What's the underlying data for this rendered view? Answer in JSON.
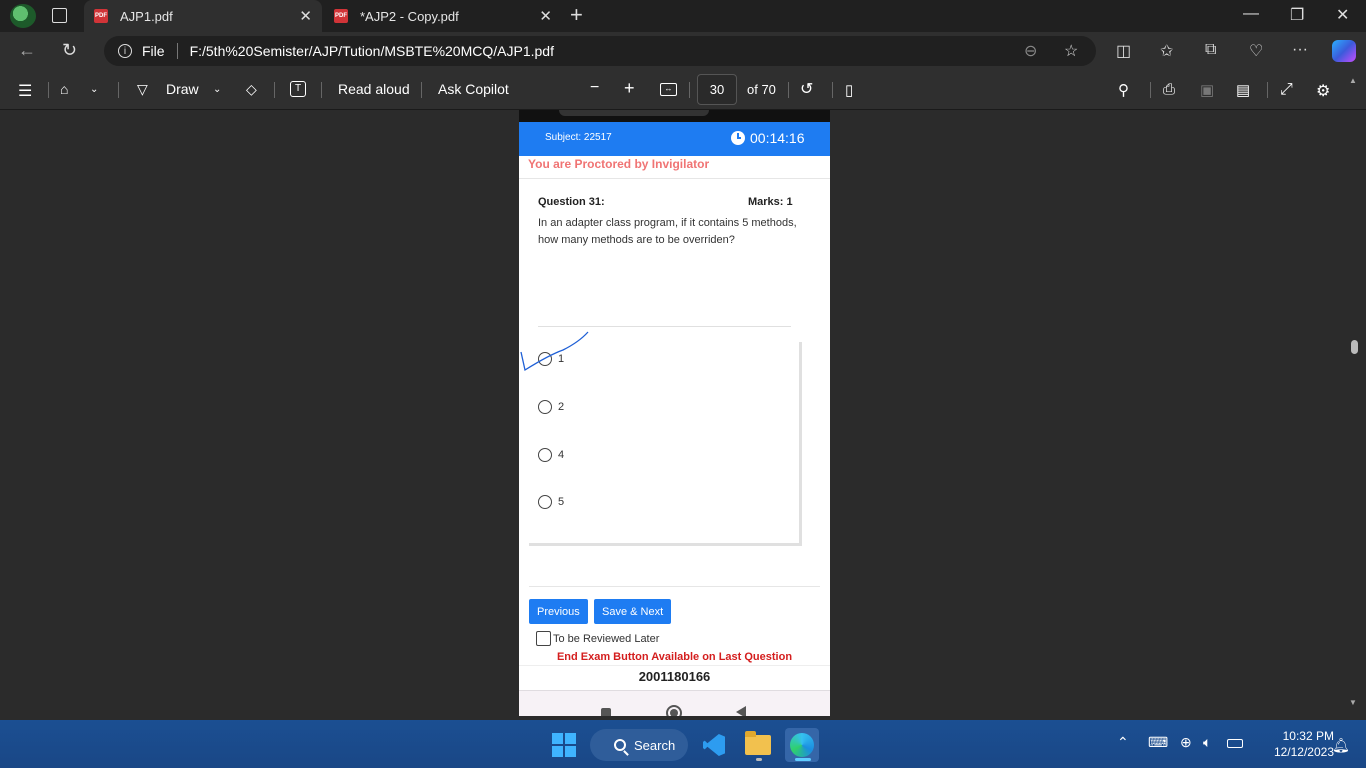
{
  "tabs": [
    {
      "title": "AJP1.pdf",
      "active": true
    },
    {
      "title": "*AJP2 - Copy.pdf",
      "active": false
    }
  ],
  "address": {
    "scheme_label": "File",
    "url": "F:/5th%20Semister/AJP/Tution/MSBTE%20MCQ/AJP1.pdf"
  },
  "pdf_toolbar": {
    "draw_label": "Draw",
    "read_aloud_label": "Read aloud",
    "ask_copilot_label": "Ask Copilot",
    "page_number": "30",
    "page_total": "of 70"
  },
  "exam": {
    "subject": "Subject: 22517",
    "timer": "00:14:16",
    "proctor_notice": "You are Proctored by Invigilator",
    "question_number": "Question 31:",
    "marks": "Marks: 1",
    "question_text": "In an adapter class program, if it contains 5 methods, how many methods are to be overriden?",
    "options": [
      {
        "label": "1"
      },
      {
        "label": "2"
      },
      {
        "label": "4"
      },
      {
        "label": "5"
      }
    ],
    "previous_label": "Previous",
    "save_next_label": "Save & Next",
    "review_label": "To be Reviewed Later",
    "end_exam_notice": "End Exam Button Available on Last Question",
    "roll_number": "2001180166"
  },
  "taskbar": {
    "search_label": "Search",
    "time": "10:32 PM",
    "date": "12/12/2023"
  },
  "colors": {
    "exam_header": "#1e7cf2",
    "proctor_text": "#f07474",
    "end_exam_text": "#d41e1e",
    "annotation_ink": "#1e5fd6"
  },
  "icons": [
    "profile-icon",
    "tab-actions-icon",
    "pdf-icon",
    "close-icon",
    "plus-icon",
    "minimize-icon",
    "restore-icon",
    "back-icon",
    "refresh-icon",
    "info-icon",
    "zoom-out-icon",
    "star-icon",
    "split-screen-icon",
    "favorites-icon",
    "collections-icon",
    "performance-icon",
    "more-icon",
    "copilot-icon",
    "contents-icon",
    "highlight-icon",
    "draw-icon",
    "eraser-icon",
    "text-icon",
    "fit-page-icon",
    "rotate-icon",
    "page-view-icon",
    "search-icon",
    "print-icon",
    "save-icon",
    "save-as-icon",
    "fullscreen-icon",
    "settings-icon",
    "clock-icon",
    "windows-logo-icon",
    "vscode-icon",
    "file-explorer-icon",
    "edge-icon",
    "chevron-up-icon",
    "keyboard-icon",
    "globe-icon",
    "speaker-icon",
    "battery-icon",
    "bell-icon"
  ]
}
